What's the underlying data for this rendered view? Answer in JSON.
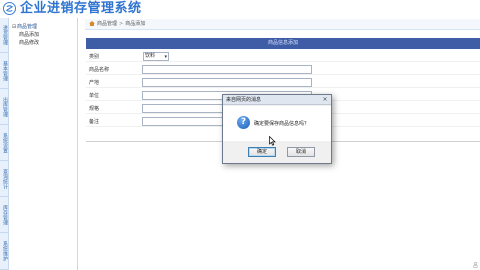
{
  "app": {
    "title": "企业进销存管理系统"
  },
  "vtabs": [
    {
      "label": "进货管理"
    },
    {
      "label": "基本管理"
    },
    {
      "label": "出库管理"
    },
    {
      "label": "系统设置"
    },
    {
      "label": "查询统计"
    },
    {
      "label": "库存管理"
    },
    {
      "label": "系统维护"
    }
  ],
  "tree": {
    "root": "商品管理",
    "items": [
      "商品添加",
      "商品修改"
    ]
  },
  "breadcrumb": {
    "part1": "商品管理",
    "part2": "商品添加",
    "separator": ">"
  },
  "form": {
    "header": "商品信息添加",
    "fields": [
      {
        "label": "类别",
        "value": "饮料"
      },
      {
        "label": "商品名称",
        "value": ""
      },
      {
        "label": "产地",
        "value": ""
      },
      {
        "label": "单位",
        "value": ""
      },
      {
        "label": "规格",
        "value": ""
      },
      {
        "label": "备注",
        "value": ""
      }
    ]
  },
  "dialog": {
    "title": "来自网页的消息",
    "close_glyph": "×",
    "icon_glyph": "?",
    "message": "确定要保存商品信息吗？",
    "ok_label": "确定",
    "cancel_label": "取消"
  },
  "corner": {
    "text": "吕"
  },
  "colors": {
    "title_blue": "#2f74d0",
    "form_header_bg": "#3f5ca6"
  }
}
